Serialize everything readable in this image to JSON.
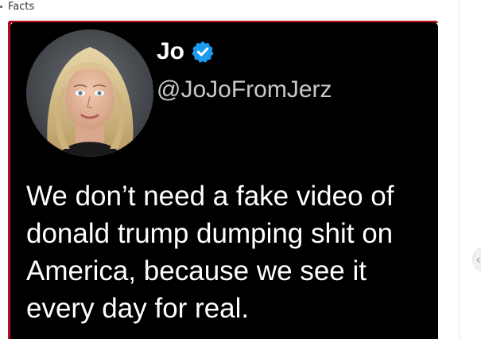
{
  "header": {
    "label": "Facts"
  },
  "post": {
    "display_name": "Jo",
    "verified": true,
    "handle": "@JoJoFromJerz",
    "text": "We don’t need a fake video of donald trump dumping shit on America, because we see it every day for real."
  },
  "colors": {
    "card_background": "#000000",
    "accent_red": "#b4121b",
    "verified_blue": "#1d9bf0",
    "handle_gray": "#c9c9c9"
  },
  "icons": {
    "verified": "verified-badge-icon",
    "scroll": "chevron-left-icon"
  }
}
